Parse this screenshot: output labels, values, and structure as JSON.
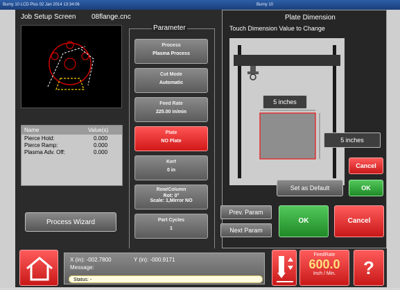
{
  "titlebar": {
    "left": "Burny 10 LCD Plus   02 Jan 2014  13:34:06",
    "right": "Burny 10"
  },
  "job": {
    "title": "Job Setup Screen",
    "file": "08flange.cnc"
  },
  "parameter_header": "Parameter",
  "parameters": [
    {
      "label": "Process",
      "value": "Plasma Process"
    },
    {
      "label": "Cut Mode",
      "value": "Automatic"
    },
    {
      "label": "Feed Rate",
      "value": "225.00 in/min"
    },
    {
      "label": "Plate",
      "value": "NO Plate"
    },
    {
      "label": "Kerf",
      "value": "0 in"
    },
    {
      "label": "Row/Column",
      "value_line1": "Rot: 0°",
      "value_line2": "Scale: 1,Mirror NO"
    },
    {
      "label": "Part Cycles",
      "value": "1"
    }
  ],
  "table": {
    "headers": {
      "name": "Name",
      "value": "Value(s)"
    },
    "rows": [
      {
        "name": "Pierce Hold:",
        "value": "0.000"
      },
      {
        "name": "Pierce Ramp:",
        "value": "0.000"
      },
      {
        "name": "Plasma Adv. Off:",
        "value": "0.000"
      }
    ]
  },
  "process_wizard": "Process Wizard",
  "dimension_dialog": {
    "title": "Plate Dimension",
    "subtitle": "Touch Dimension Value to Change",
    "width_value": "5 inches",
    "height_value": "5 inches",
    "cancel_small": "Cancel",
    "set_default": "Set as Default",
    "ok_small": "OK"
  },
  "nav": {
    "prev": "Prev. Param",
    "next": "Next  Param"
  },
  "actions": {
    "ok": "OK",
    "cancel": "Cancel"
  },
  "status": {
    "x_label": "X (in): -002.7800",
    "y_label": "Y (in): -000.9171",
    "message_label": "Message:",
    "status_label": "Status: -"
  },
  "feedrate": {
    "label": "FeedRate",
    "value": "600.0",
    "unit": "Inch / Min."
  },
  "icons": [
    "home-icon",
    "torch-up-down-icon",
    "help-icon"
  ]
}
